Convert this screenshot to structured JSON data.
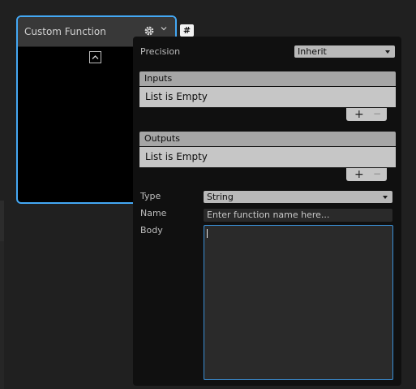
{
  "node": {
    "title": "Custom Function",
    "gear_icon": "gear-icon",
    "chevron_icon": "chevron-down-icon",
    "collapse_icon": "chevron-up-icon"
  },
  "hash_badge": "#",
  "panel": {
    "precision": {
      "label": "Precision",
      "value": "Inherit"
    },
    "inputs": {
      "header": "Inputs",
      "empty_text": "List is Empty",
      "add": "+",
      "remove": "−"
    },
    "outputs": {
      "header": "Outputs",
      "empty_text": "List is Empty",
      "add": "+",
      "remove": "−"
    },
    "type": {
      "label": "Type",
      "value": "String"
    },
    "name": {
      "label": "Name",
      "placeholder": "Enter function name here..."
    },
    "body": {
      "label": "Body",
      "value": ""
    }
  },
  "colors": {
    "accent": "#44a8f4",
    "panel_bg": "#101010",
    "list_bg": "#c6c6c6"
  }
}
